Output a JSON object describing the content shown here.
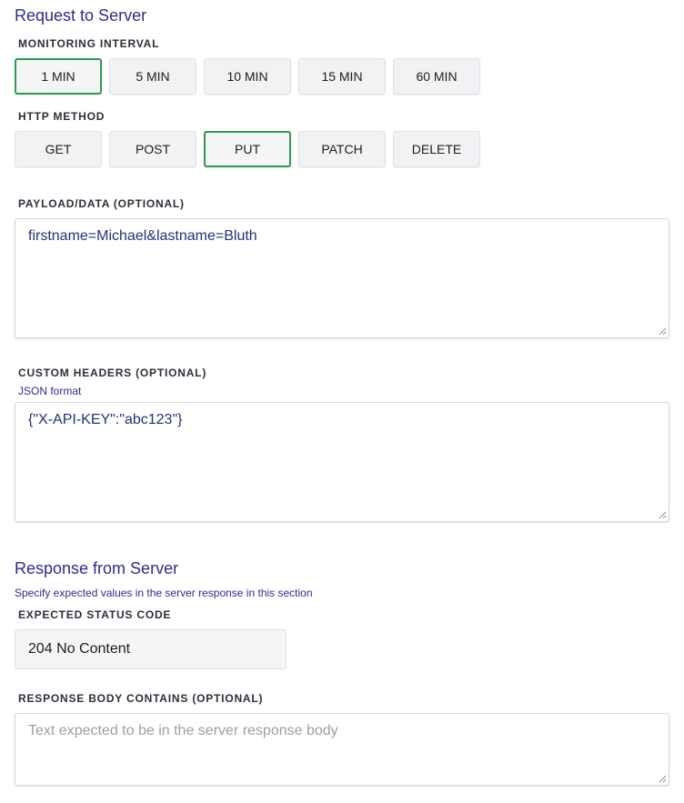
{
  "request": {
    "title": "Request to Server",
    "interval": {
      "label": "MONITORING INTERVAL",
      "options": [
        "1 MIN",
        "5 MIN",
        "10 MIN",
        "15 MIN",
        "60 MIN"
      ],
      "selected": "1 MIN"
    },
    "method": {
      "label": "HTTP METHOD",
      "options": [
        "GET",
        "POST",
        "PUT",
        "PATCH",
        "DELETE"
      ],
      "selected": "PUT"
    },
    "payload": {
      "label": "PAYLOAD/DATA (OPTIONAL)",
      "value": "firstname=Michael&lastname=Bluth"
    },
    "headers": {
      "label": "CUSTOM HEADERS (OPTIONAL)",
      "hint": "JSON format",
      "value": "{\"X-API-KEY\":\"abc123\"}"
    }
  },
  "response": {
    "title": "Response from Server",
    "hint": "Specify expected values in the server response in this section",
    "status": {
      "label": "EXPECTED STATUS CODE",
      "value": "204 No Content"
    },
    "body": {
      "label": "RESPONSE BODY CONTAINS (OPTIONAL)",
      "placeholder": "Text expected to be in the server response body",
      "value": ""
    }
  },
  "colors": {
    "accent_green": "#2e9a55",
    "title_blue": "#2d2d8f"
  }
}
